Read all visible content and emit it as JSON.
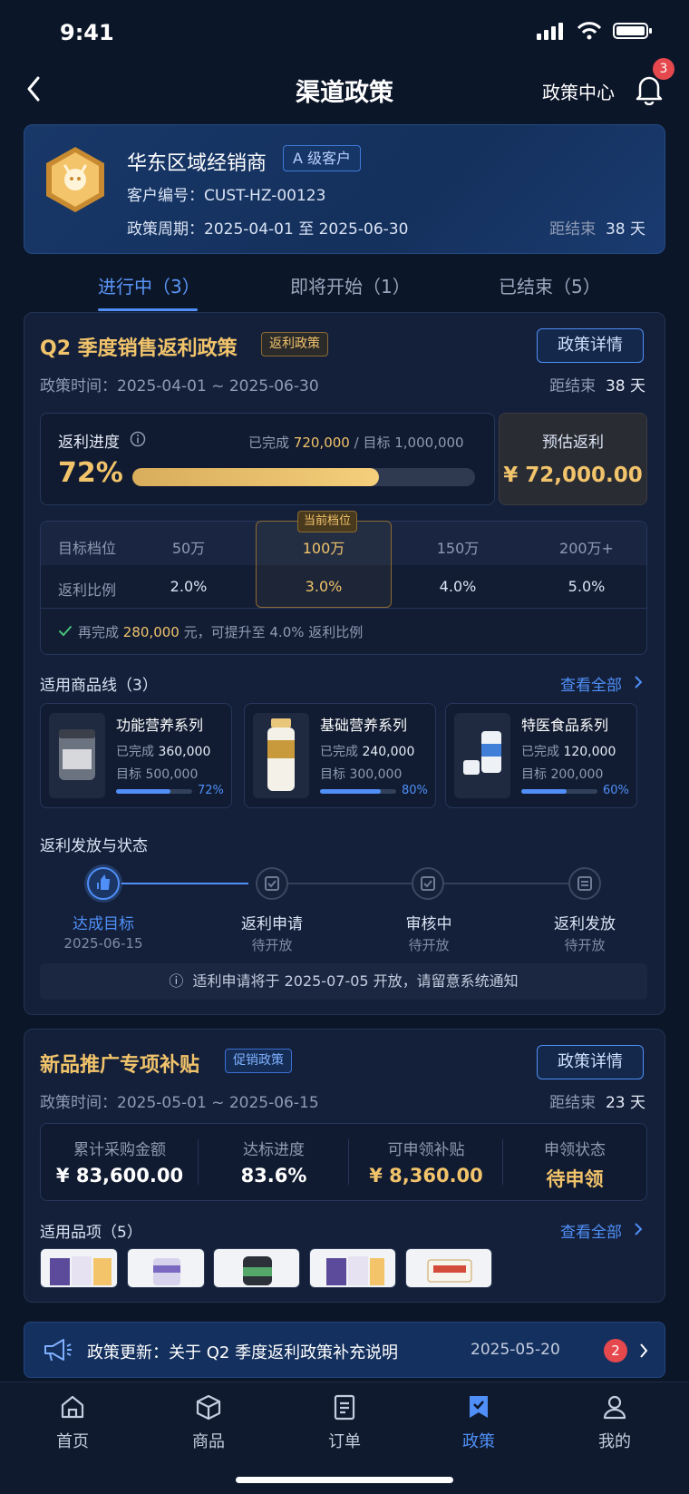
{
  "status_bar": {
    "time": "9:41"
  },
  "header": {
    "title": "渠道政策",
    "policy_center": "政策中心",
    "notification_count": "3"
  },
  "customer": {
    "name": "华东区域经销商",
    "level": "A 级客户",
    "id_label": "客户编号：",
    "id": "CUST-HZ-00123",
    "period_label": "政策周期：",
    "period": "2025-04-01 至 2025-06-30",
    "days_left_label": "距结束",
    "days_left": "38 天"
  },
  "tabs": [
    {
      "label": "进行中（3）"
    },
    {
      "label": "即将开始（1）"
    },
    {
      "label": "已结束（5）"
    }
  ],
  "policy1": {
    "title": "Q2 季度销售返利政策",
    "tag": "返利政策",
    "detail_button": "政策详情",
    "time_label": "政策时间：",
    "time": "2025-04-01 ~ 2025-06-30",
    "days_left_label": "距结束",
    "days_left": "38 天",
    "progress_label": "返利进度",
    "completed_label": "已完成",
    "completed": "720,000",
    "slash": "/",
    "target_label": "目标",
    "target": "1,000,000",
    "progress_pct": "72%",
    "progress_value": 0.72,
    "estimate_label": "预估返利",
    "estimate": "¥ 72,000.00",
    "tiers": {
      "row1_label": "目标档位",
      "row2_label": "返利比例",
      "current_label": "当前档位",
      "levels": [
        "50万",
        "100万",
        "150万",
        "200万+"
      ],
      "rates": [
        "2.0%",
        "3.0%",
        "4.0%",
        "5.0%"
      ],
      "hint_prefix": "再完成",
      "hint_amount": "280,000",
      "hint_suffix": "元，可提升至 4.0% 返利比例"
    },
    "products_title": "适用商品线（3）",
    "view_all": "查看全部",
    "products": [
      {
        "name": "功能营养系列",
        "done_label": "已完成",
        "done": "360,000",
        "target_label": "目标",
        "target": "500,000",
        "pct": "72%",
        "ratio": 0.72
      },
      {
        "name": "基础营养系列",
        "done_label": "已完成",
        "done": "240,000",
        "target_label": "目标",
        "target": "300,000",
        "pct": "80%",
        "ratio": 0.8
      },
      {
        "name": "特医食品系列",
        "done_label": "已完成",
        "done": "120,000",
        "target_label": "目标",
        "target": "200,000",
        "pct": "60%",
        "ratio": 0.6
      }
    ],
    "status_title": "返利发放与状态",
    "steps": [
      {
        "label": "达成目标",
        "sub": "2025-06-15"
      },
      {
        "label": "返利申请",
        "sub": "待开放"
      },
      {
        "label": "审核中",
        "sub": "待开放"
      },
      {
        "label": "返利发放",
        "sub": "待开放"
      }
    ],
    "notice": "适利申请将于 2025-07-05 开放，请留意系统通知"
  },
  "policy2": {
    "title": "新品推广专项补贴",
    "tag": "促销政策",
    "detail_button": "政策详情",
    "time_label": "政策时间：",
    "time": "2025-05-01 ~ 2025-06-15",
    "days_left_label": "距结束",
    "days_left": "23 天",
    "stats": [
      {
        "label": "累计采购金额",
        "value": "¥ 83,600.00"
      },
      {
        "label": "达标进度",
        "value": "83.6%"
      },
      {
        "label": "可申领补贴",
        "value": "¥ 8,360.00"
      },
      {
        "label": "申领状态",
        "value": "待申领"
      }
    ],
    "items_title": "适用品项（5）",
    "view_all": "查看全部"
  },
  "announcement": {
    "prefix": "政策更新：",
    "text": "关于 Q2 季度返利政策补充说明",
    "date": "2025-05-20",
    "count": "2"
  },
  "nav": [
    {
      "label": "首页",
      "icon": "home-icon"
    },
    {
      "label": "商品",
      "icon": "box-icon"
    },
    {
      "label": "订单",
      "icon": "order-icon"
    },
    {
      "label": "政策",
      "icon": "policy-icon"
    },
    {
      "label": "我的",
      "icon": "user-icon"
    }
  ],
  "colors": {
    "accent": "#4f8ff7",
    "gold": "#f1c36b",
    "bg": "#0c1629"
  }
}
